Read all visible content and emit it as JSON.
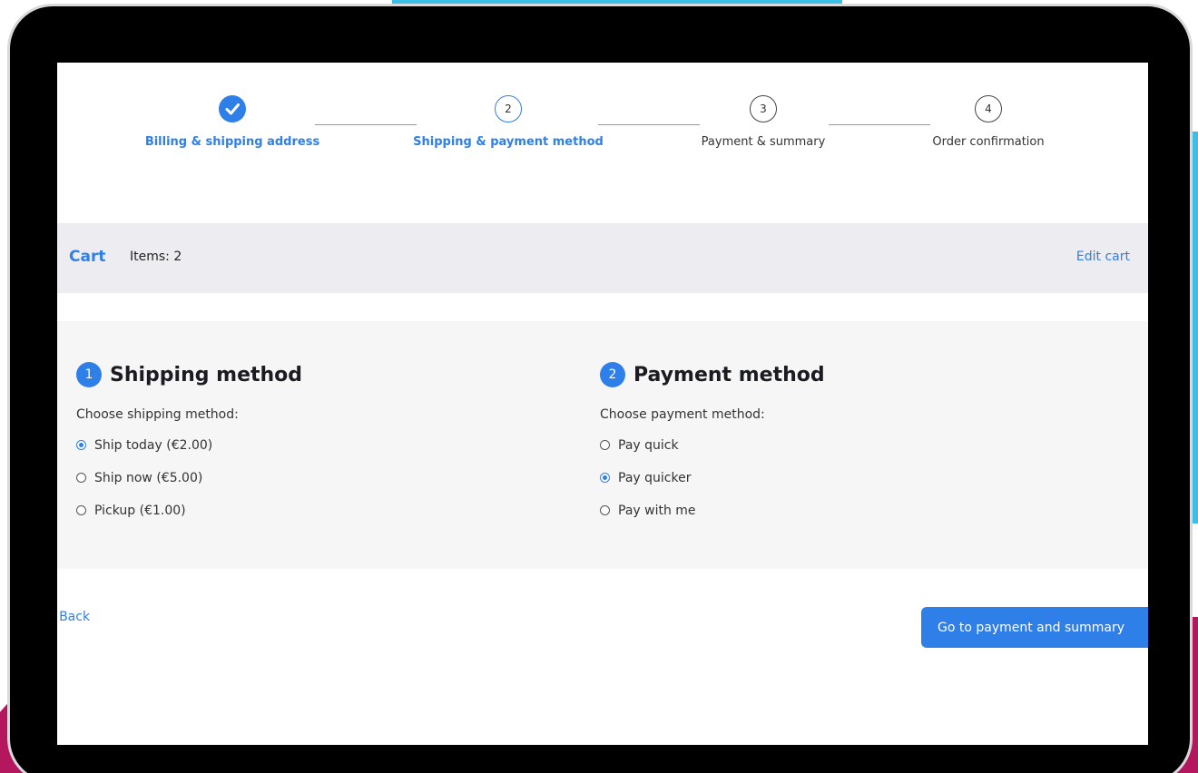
{
  "stepper": {
    "steps": [
      {
        "label": "Billing & shipping address",
        "state": "done",
        "icon": "check-icon"
      },
      {
        "label": "Shipping & payment method",
        "state": "active",
        "number": "2"
      },
      {
        "label": "Payment & summary",
        "state": "todo",
        "number": "3"
      },
      {
        "label": "Order confirmation",
        "state": "todo",
        "number": "4"
      }
    ]
  },
  "cart": {
    "title": "Cart",
    "items": "Items: 2",
    "edit_label": "Edit cart"
  },
  "shipping": {
    "number": "1",
    "title": "Shipping method",
    "prompt": "Choose shipping method:",
    "options": [
      {
        "label": "Ship today (€2.00)",
        "checked": true
      },
      {
        "label": "Ship now (€5.00)",
        "checked": false
      },
      {
        "label": "Pickup (€1.00)",
        "checked": false
      }
    ]
  },
  "payment": {
    "number": "2",
    "title": "Payment method",
    "prompt": "Choose payment method:",
    "options": [
      {
        "label": "Pay quick",
        "checked": false
      },
      {
        "label": "Pay quicker",
        "checked": true
      },
      {
        "label": "Pay with me",
        "checked": false
      }
    ]
  },
  "footer": {
    "back_label": "Back",
    "next_label": "Go to payment and summary"
  },
  "colors": {
    "accent": "#2f7fe8",
    "panel": "#f6f6f7",
    "cart_bar": "#ececf1",
    "frame_accent_cyan": "#3bbfe6",
    "frame_accent_magenta": "#b5175f"
  }
}
